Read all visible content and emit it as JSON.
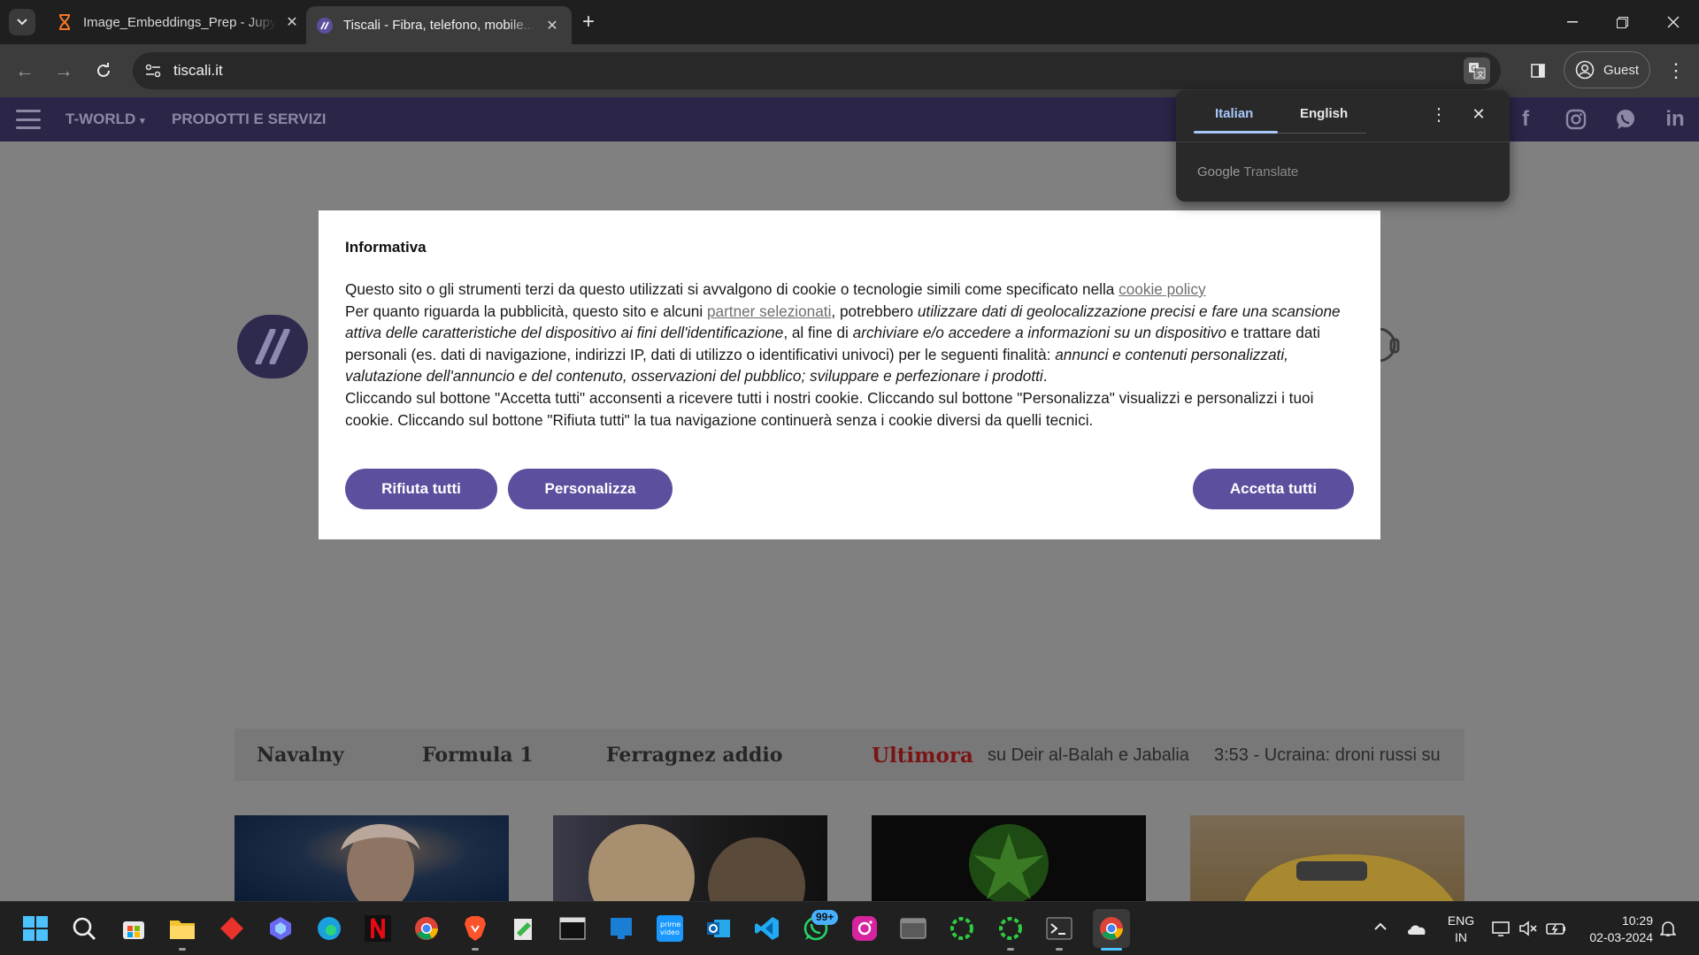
{
  "tabs": [
    {
      "title": "Image_Embeddings_Prep - Jupyter",
      "icon": "hourglass-icon",
      "active": false
    },
    {
      "title": "Tiscali - Fibra, telefono, mobile...",
      "icon": "tiscali-icon",
      "active": true
    }
  ],
  "toolbar": {
    "url": "tiscali.it",
    "profile_label": "Guest"
  },
  "site_nav": {
    "items": [
      "T-WORLD",
      "PRODOTTI E SERVIZI"
    ]
  },
  "cookie_banner": {
    "title": "Informativa",
    "p1_text": "Questo sito o gli strumenti terzi da questo utilizzati si avvalgono di cookie o tecnologie simili come specificato nella ",
    "p1_link": "cookie policy",
    "p2_a": "Per quanto riguarda la pubblicità, questo sito e alcuni ",
    "p2_link": "partner selezionati",
    "p2_b": ", potrebbero ",
    "p2_em1": "utilizzare dati di geolocalizzazione precisi e fare una scansione attiva delle caratteristiche del dispositivo ai fini dell'identificazione",
    "p2_c": ", al fine di ",
    "p2_em2": "archiviare e/o accedere a informazioni su un dispositivo",
    "p2_d": " e trattare dati personali (es. dati di navigazione, indirizzi IP, dati di utilizzo o identificativi univoci) per le seguenti finalità: ",
    "p2_em3": "annunci e contenuti personalizzati, valutazione dell'annuncio e del contenuto, osservazioni del pubblico; sviluppare e perfezionare i prodotti",
    "p2_e": ".",
    "p3": "Cliccando sul bottone \"Accetta tutti\" acconsenti a ricevere tutti i nostri cookie. Cliccando sul bottone \"Personalizza\" visualizzi e personalizzi i tuoi cookie. Cliccando sul bottone \"Rifiuta tutti\" la tua navigazione continuerà senza i cookie diversi da quelli tecnici.",
    "reject_label": "Rifiuta tutti",
    "customize_label": "Personalizza",
    "accept_label": "Accetta tutti",
    "button_color": "#5b4f9e"
  },
  "translate_popup": {
    "lang_source": "Italian",
    "lang_target": "English",
    "brand_google": "Google",
    "brand_translate": "Translate"
  },
  "ticker": {
    "topics": [
      "Navalny",
      "Formula 1",
      "Ferragnez addio"
    ],
    "ultimora_label": "Ultimora",
    "news": [
      "su Deir al-Balah e Jabalia",
      "3:53 - Ucraina: droni russi su"
    ]
  },
  "taskbar": {
    "whatsapp_badge": "99+",
    "lang_line1": "ENG",
    "lang_line2": "IN",
    "time": "10:29",
    "date": "02-03-2024"
  }
}
